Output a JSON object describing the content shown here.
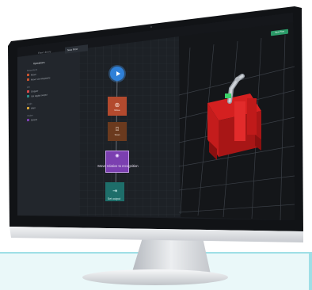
{
  "window": {
    "tabs": [
      {
        "label": "Flow Library"
      },
      {
        "label": "New Flow"
      }
    ],
    "action_button_label": "Save Flow"
  },
  "sidebar": {
    "title": "Operations",
    "groups": [
      {
        "header": "Movement",
        "items": [
          "Move",
          "Move via waypoints"
        ]
      },
      {
        "header": "I/O",
        "items": [
          "Gripper",
          "Set digital output"
        ]
      },
      {
        "header": "Logic",
        "items": [
          "Wait"
        ]
      },
      {
        "header": "Vision",
        "items": [
          "Detect"
        ]
      }
    ]
  },
  "flow": {
    "nodes": [
      {
        "label": "",
        "icon": "play-icon",
        "color": "#2f80d8"
      },
      {
        "label": "Move",
        "icon": "move-icon",
        "color": "#b34a2e"
      },
      {
        "label": "Scan",
        "icon": "camera-icon",
        "color": "#6b3a1e"
      },
      {
        "label": "Move relative to recognition",
        "icon": "eye-icon",
        "color": "#7b3fb0"
      },
      {
        "label": "Set output",
        "icon": "output-icon",
        "color": "#1e6e6a"
      }
    ]
  },
  "viewport": {
    "scene": "robot-cell-3d"
  }
}
